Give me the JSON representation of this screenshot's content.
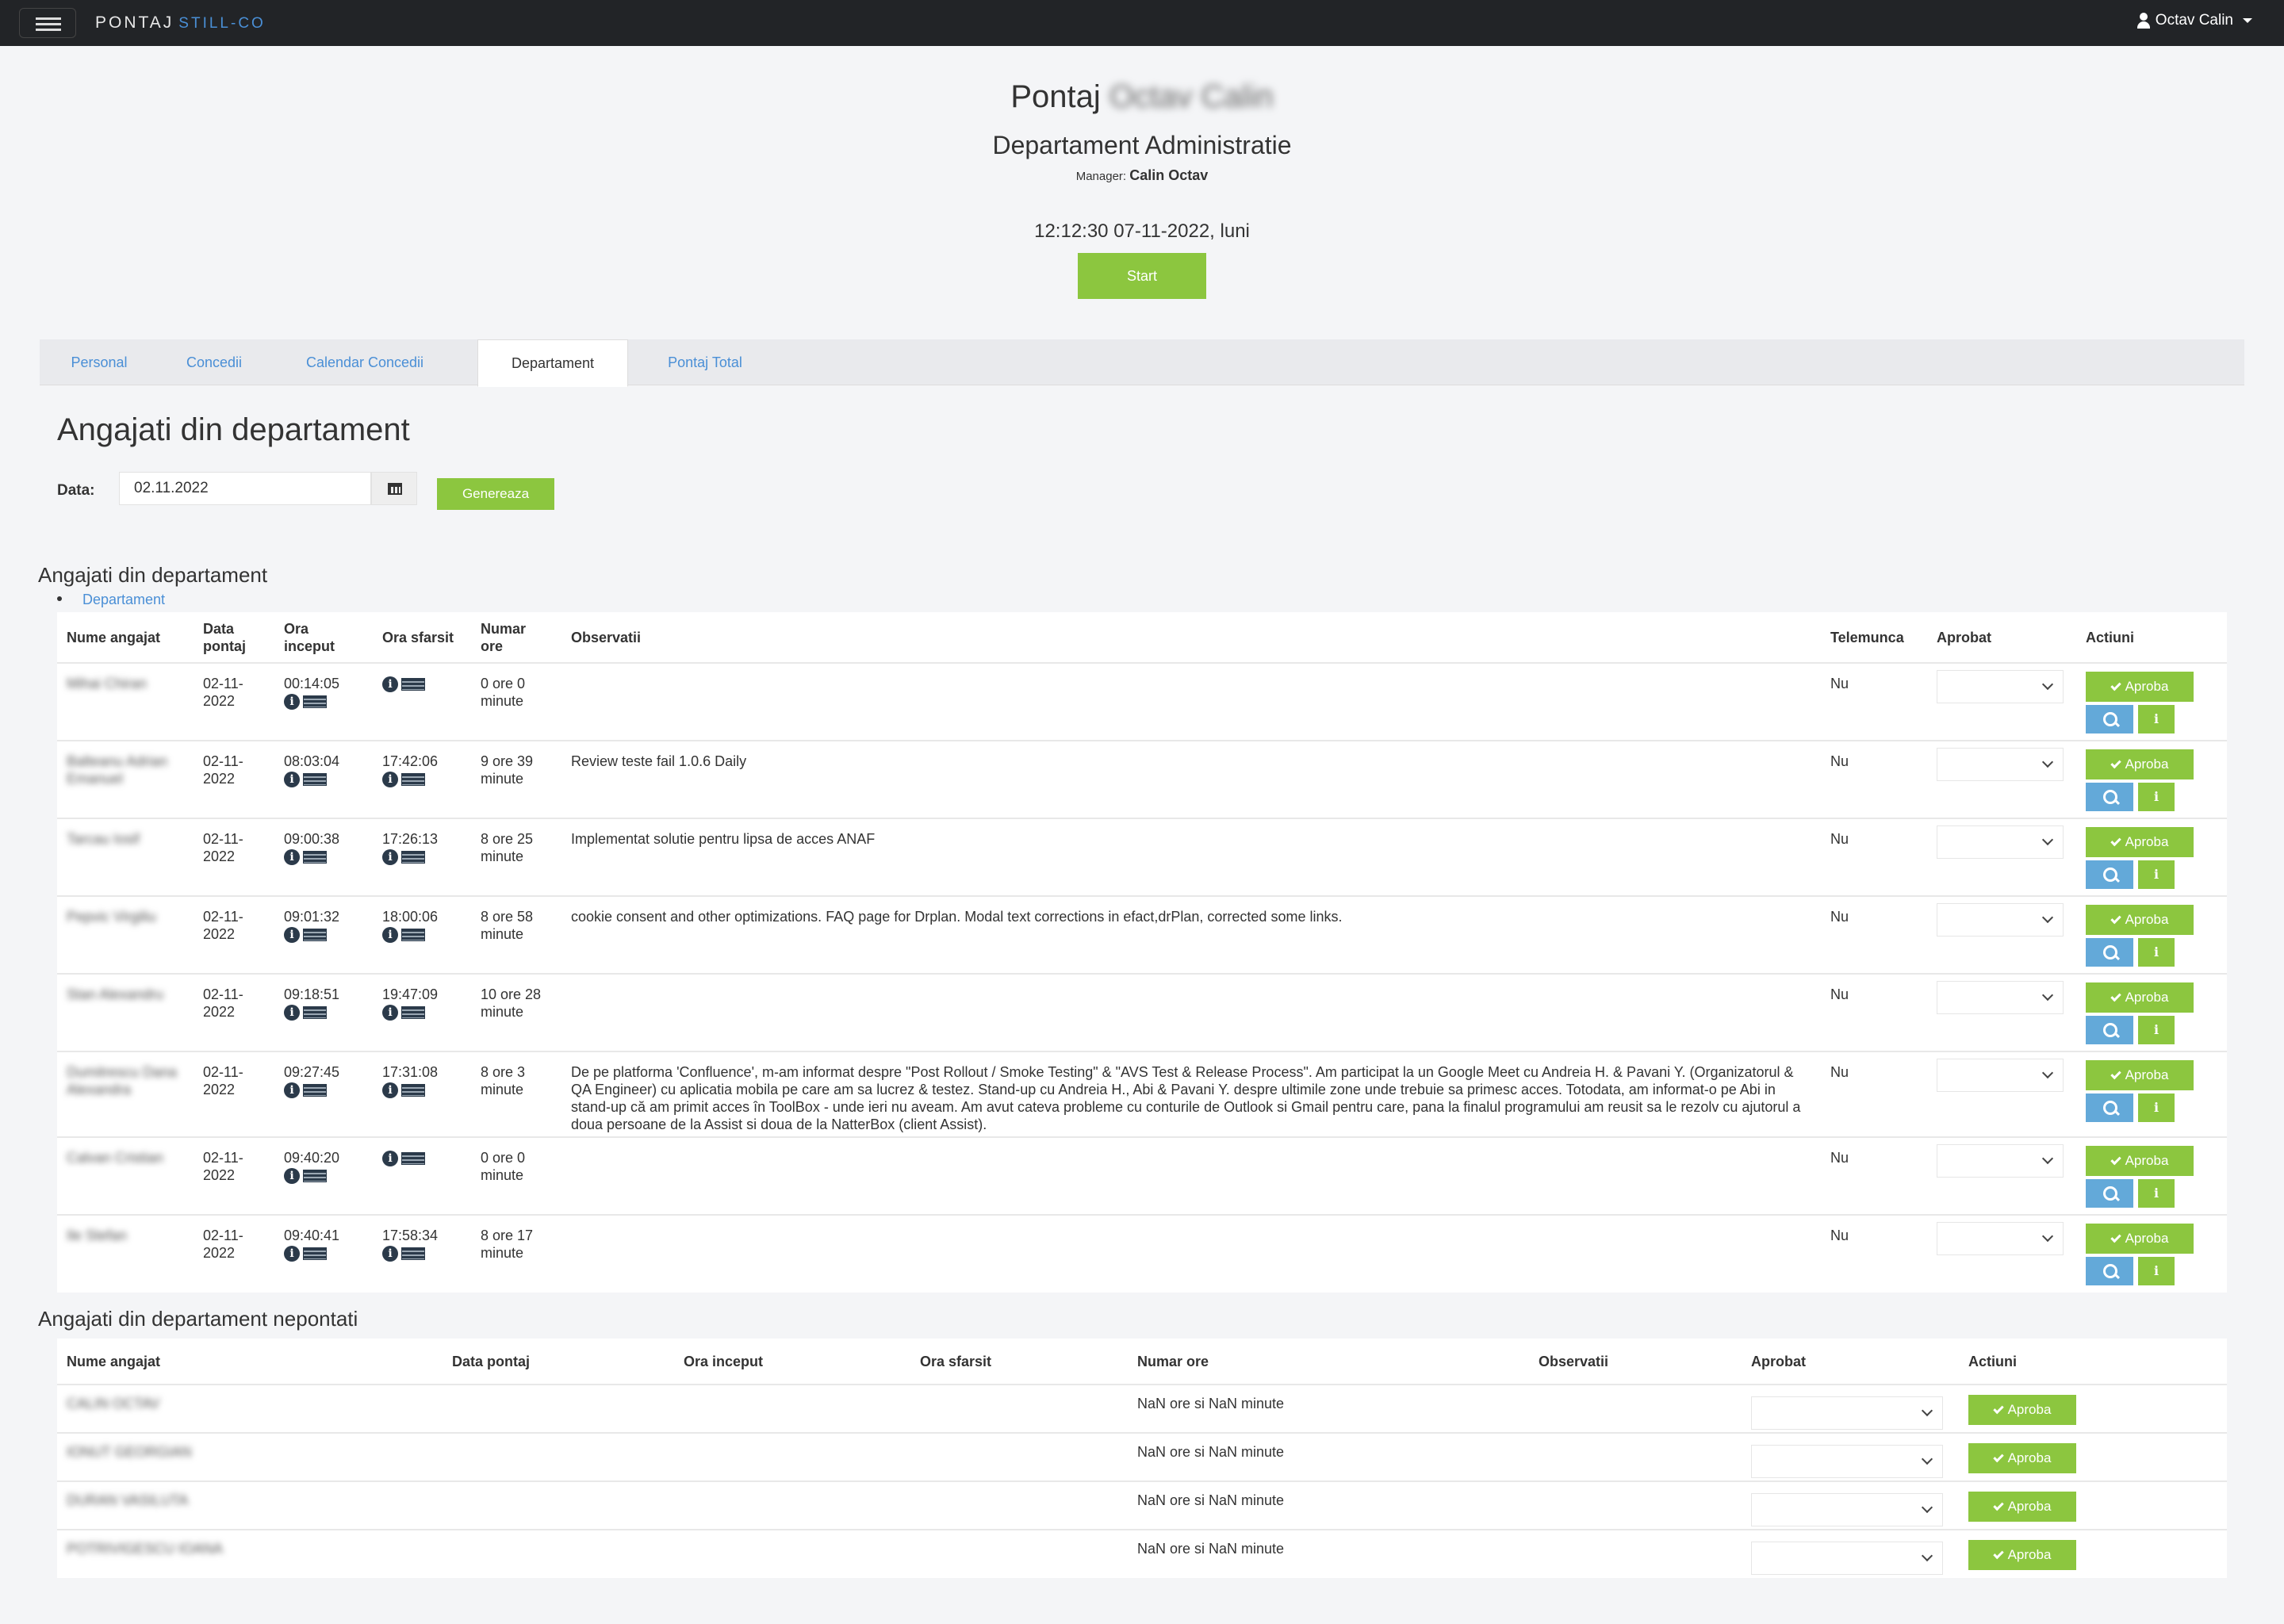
{
  "navbar": {
    "brand": "PONTAJ",
    "brand_accent": "STILL-CO",
    "user": "Octav Calin"
  },
  "header": {
    "title_prefix": "Pontaj",
    "title_name": "Octav Calin",
    "department": "Departament Administratie",
    "manager_label": "Manager:",
    "manager_name": "Calin Octav",
    "clock": "12:12:30 07-11-2022, luni",
    "start_label": "Start"
  },
  "tabs": [
    {
      "label": "Personal"
    },
    {
      "label": "Concedii"
    },
    {
      "label": "Calendar Concedii"
    },
    {
      "label": "Departament",
      "active": true
    },
    {
      "label": "Pontaj Total"
    }
  ],
  "section_title": "Angajati din departament",
  "filter": {
    "date_label": "Data:",
    "date_value": "02.11.2022",
    "generate_label": "Genereaza"
  },
  "table1": {
    "title": "Angajati din departament",
    "link": "Departament",
    "headers": [
      "Nume angajat",
      "Data pontaj",
      "Ora inceput",
      "Ora sfarsit",
      "Numar ore",
      "Observatii",
      "Telemunca",
      "Aprobat",
      "Actiuni"
    ],
    "approve_label": "Aproba",
    "rows": [
      {
        "name": "Mihai Chiran",
        "date": "02-11-2022",
        "start": "00:14:05",
        "end": "",
        "hours": "0 ore 0 minute",
        "obs": "",
        "remote": "Nu"
      },
      {
        "name": "Balteanu Adrian Emanuel",
        "date": "02-11-2022",
        "start": "08:03:04",
        "end": "17:42:06",
        "hours": "9 ore 39 minute",
        "obs": "Review teste fail 1.0.6 Daily",
        "remote": "Nu"
      },
      {
        "name": "Tarcau Iosif",
        "date": "02-11-2022",
        "start": "09:00:38",
        "end": "17:26:13",
        "hours": "8 ore 25 minute",
        "obs": "Implementat solutie pentru lipsa de acces ANAF",
        "remote": "Nu"
      },
      {
        "name": "Pepvic Virgiliu",
        "date": "02-11-2022",
        "start": "09:01:32",
        "end": "18:00:06",
        "hours": "8 ore 58 minute",
        "obs": "cookie consent and other optimizations. FAQ page for Drplan. Modal text corrections in efact,drPlan, corrected some links.",
        "remote": "Nu"
      },
      {
        "name": "Stan Alexandru",
        "date": "02-11-2022",
        "start": "09:18:51",
        "end": "19:47:09",
        "hours": "10 ore 28 minute",
        "obs": "",
        "remote": "Nu"
      },
      {
        "name": "Dumitrescu Dana Alexandra",
        "date": "02-11-2022",
        "start": "09:27:45",
        "end": "17:31:08",
        "hours": "8 ore 3 minute",
        "obs": "De pe platforma 'Confluence', m-am informat despre \"Post Rollout / Smoke Testing\" & \"AVS Test & Release Process\". Am participat la un Google Meet cu Andreia H. & Pavani Y. (Organizatorul & QA Engineer) cu aplicatia mobila pe care am sa lucrez & testez. Stand-up cu Andreia H., Abi & Pavani Y. despre ultimile zone unde trebuie sa primesc acces. Totodata, am informat-o pe Abi in stand-up că am primit acces în ToolBox - unde ieri nu aveam. Am avut cateva probleme cu conturile de Outlook si Gmail pentru care, pana la finalul programului am reusit sa le rezolv cu ajutorul a doua persoane de la Assist si doua de la NatterBox (client Assist).",
        "remote": "Nu"
      },
      {
        "name": "Calvan Cristian",
        "date": "02-11-2022",
        "start": "09:40:20",
        "end": "",
        "hours": "0 ore 0 minute",
        "obs": "",
        "remote": "Nu"
      },
      {
        "name": "Ile Stefan",
        "date": "02-11-2022",
        "start": "09:40:41",
        "end": "17:58:34",
        "hours": "8 ore 17 minute",
        "obs": "",
        "remote": "Nu"
      }
    ]
  },
  "table2": {
    "title": "Angajati din departament nepontati",
    "headers": [
      "Nume angajat",
      "Data pontaj",
      "Ora inceput",
      "Ora sfarsit",
      "Numar ore",
      "Observatii",
      "Aprobat",
      "Actiuni"
    ],
    "approve_label": "Aproba",
    "rows": [
      {
        "name": "CALIN OCTAV",
        "hours": "NaN ore si NaN minute"
      },
      {
        "name": "IONUT GEORGIAN",
        "hours": "NaN ore si NaN minute"
      },
      {
        "name": "DURAN VASILUTA",
        "hours": "NaN ore si NaN minute"
      },
      {
        "name": "POTRIVIGESCU IOANA",
        "hours": "NaN ore si NaN minute"
      }
    ]
  },
  "colors": {
    "navbar": "#222427",
    "accent_green": "#8cc63f",
    "link_blue": "#4a8fd6",
    "search_blue": "#63a9d9"
  }
}
